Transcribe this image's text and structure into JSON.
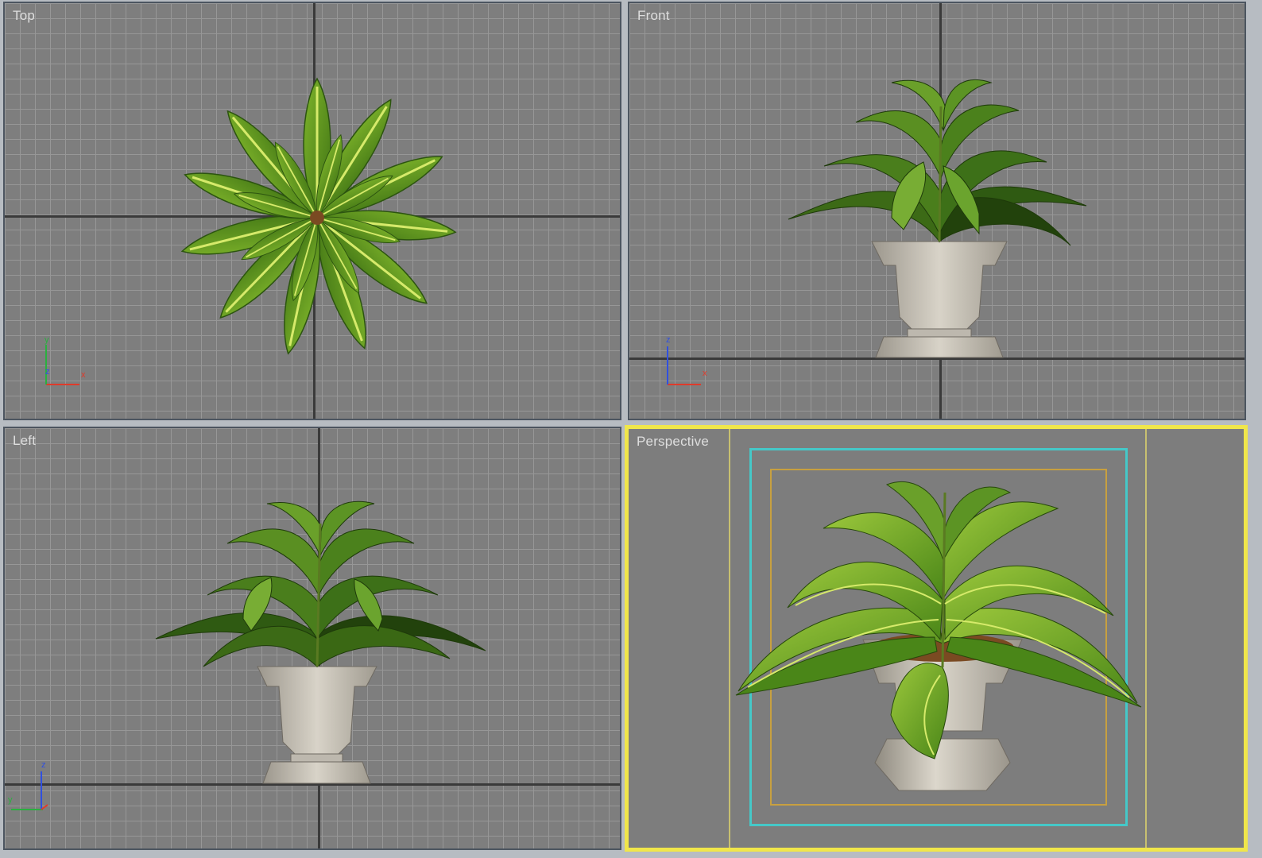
{
  "viewports": {
    "top": {
      "label": "Top"
    },
    "front": {
      "label": "Front"
    },
    "left": {
      "label": "Left"
    },
    "perspective": {
      "label": "Perspective"
    }
  },
  "axis_tripods": {
    "top": {
      "x": "x",
      "y": "y",
      "z": "z"
    },
    "front": {
      "x": "x",
      "z": "z"
    },
    "left": {
      "y": "y",
      "z": "z"
    }
  },
  "colors": {
    "viewport_bg": "#7e7e7e",
    "grid_line": "#979797",
    "active_border": "#f0e64a",
    "safe_frame_outer": "#c8c070",
    "safe_frame_action": "#45c8c8",
    "safe_frame_title": "#c8a040",
    "leaf_green": "#5c9a1c",
    "leaf_light": "#c6e05a",
    "pot_stone": "#c9c4ba"
  },
  "icons": [
    "plant-object",
    "axis-tripod-icon"
  ]
}
